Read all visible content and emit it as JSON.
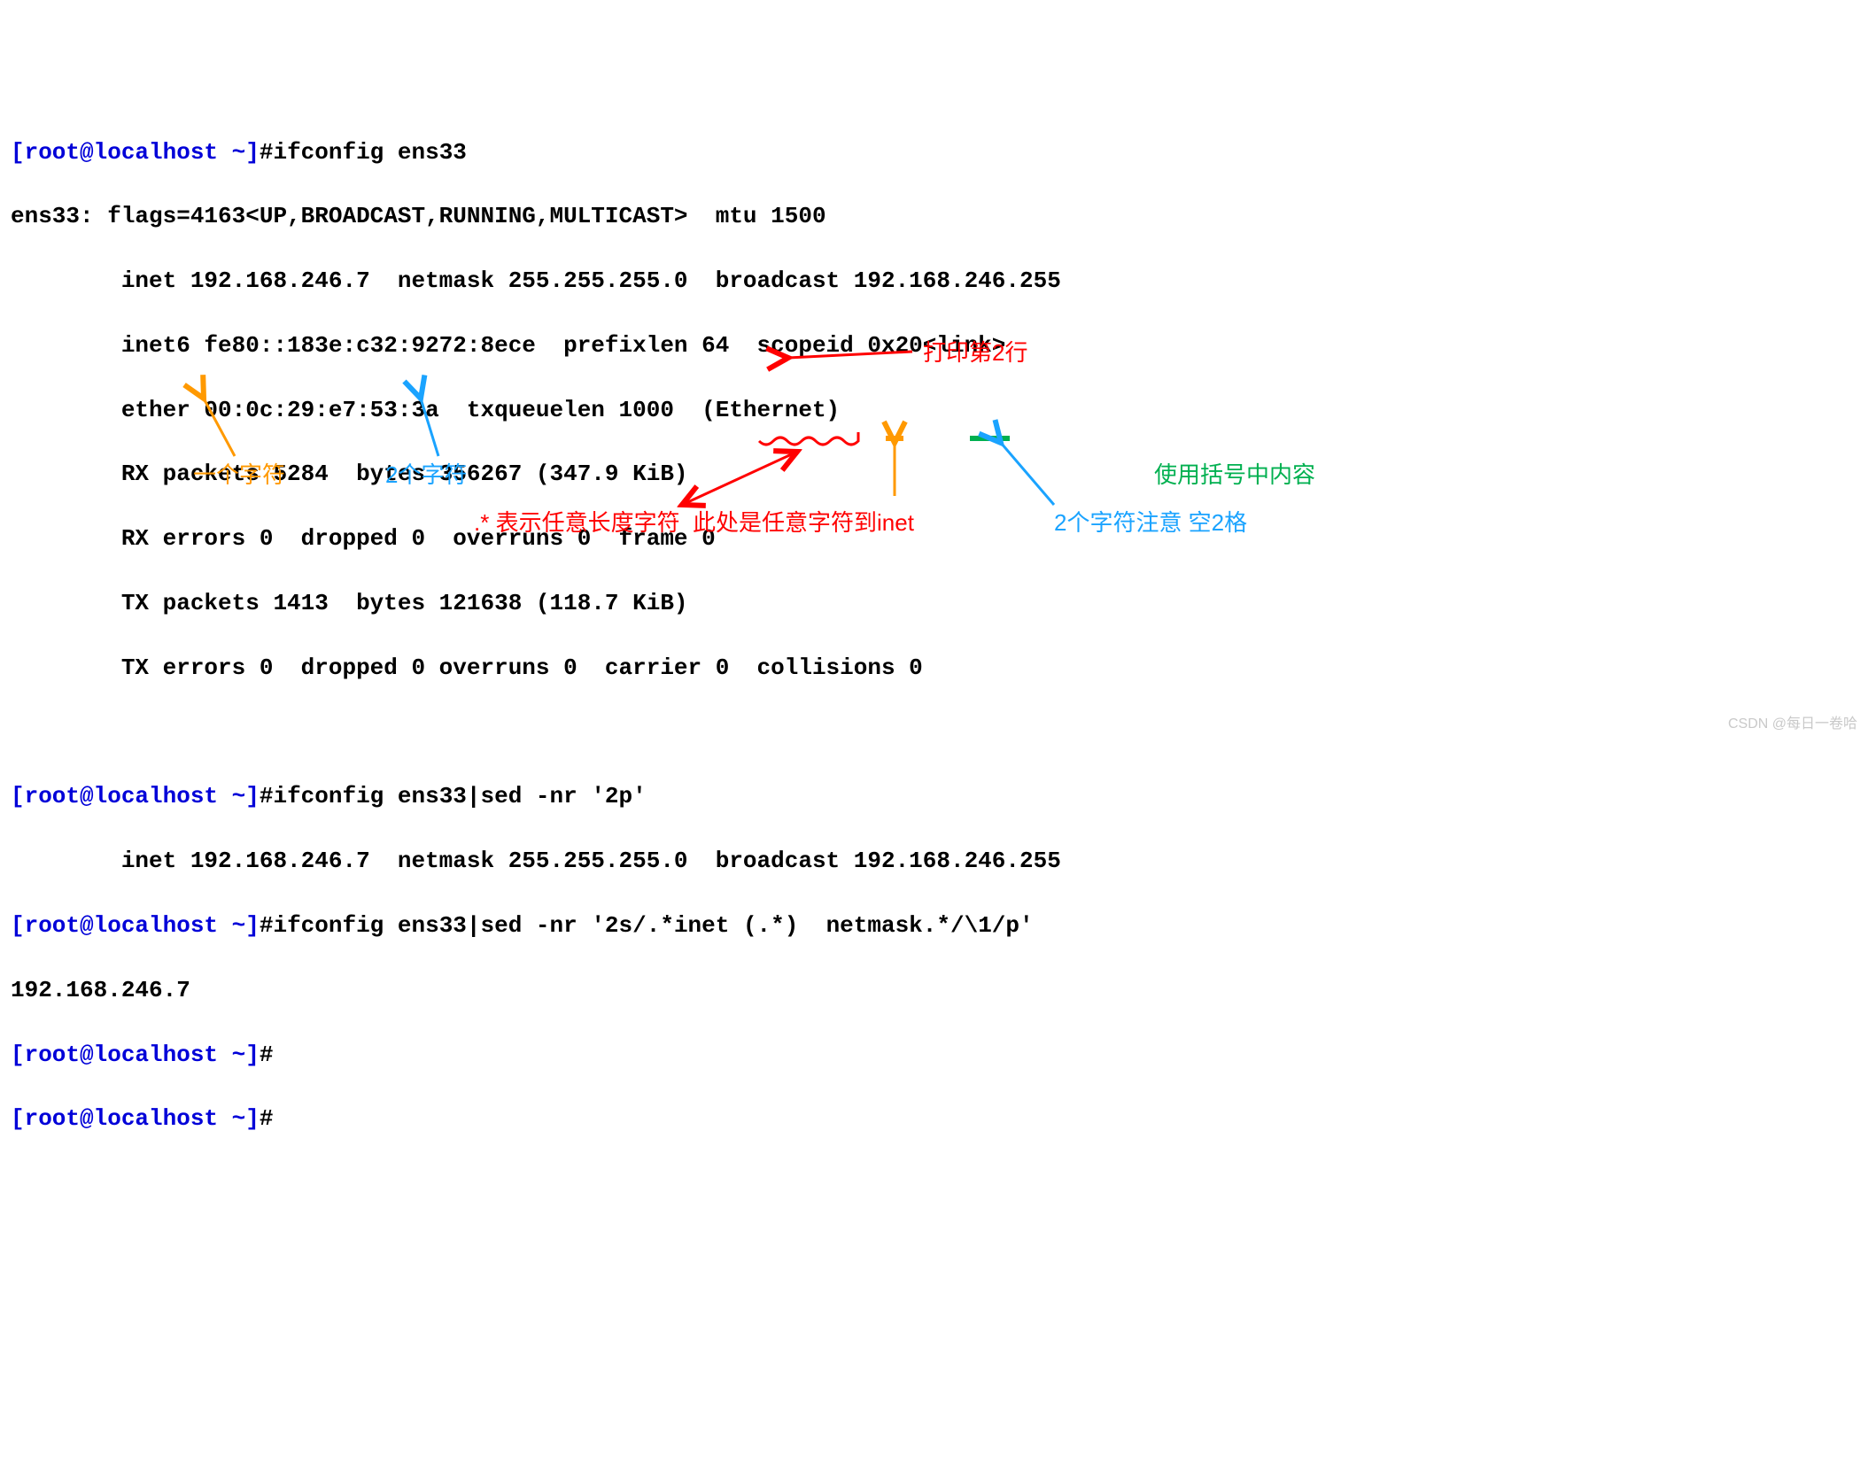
{
  "prompt1": {
    "user": "[root@localhost ~]",
    "hash": "#",
    "cmd": "ifconfig ens33"
  },
  "out1": {
    "l1": "ens33: flags=4163<UP,BROADCAST,RUNNING,MULTICAST>  mtu 1500",
    "l2": "        inet 192.168.246.7  netmask 255.255.255.0  broadcast 192.168.246.255",
    "l3": "        inet6 fe80::183e:c32:9272:8ece  prefixlen 64  scopeid 0x20<link>",
    "l4": "        ether 00:0c:29:e7:53:3a  txqueuelen 1000  (Ethernet)",
    "l5": "        RX packets 5284  bytes 356267 (347.9 KiB)",
    "l6": "        RX errors 0  dropped 0  overruns 0  frame 0",
    "l7": "        TX packets 1413  bytes 121638 (118.7 KiB)",
    "l8": "        TX errors 0  dropped 0 overruns 0  carrier 0  collisions 0"
  },
  "prompt2": {
    "user": "[root@localhost ~]",
    "hash": "#",
    "cmd": "ifconfig ens33|sed -nr '2p'"
  },
  "out2": "        inet 192.168.246.7  netmask 255.255.255.0  broadcast 192.168.246.255",
  "prompt3": {
    "user": "[root@localhost ~]",
    "hash": "#",
    "cmd": "ifconfig ens33|sed -nr '2s/.*inet (.*)  netmask.*/\\1/p'"
  },
  "out3": "192.168.246.7",
  "prompt4": {
    "user": "[root@localhost ~]",
    "hash": "#"
  },
  "prompt5": {
    "user": "[root@localhost ~]",
    "hash": "#"
  },
  "ann": {
    "print_line2": "打印第2行",
    "one_char": "一个字符",
    "two_chars": "2个字符",
    "any_len": ".* 表示任意长度字符  此处是任意字符到inet",
    "two_chars_space": "2个字符注意 空2格",
    "use_paren": "使用括号中内容"
  },
  "watermark": "CSDN @每日一卷哈"
}
